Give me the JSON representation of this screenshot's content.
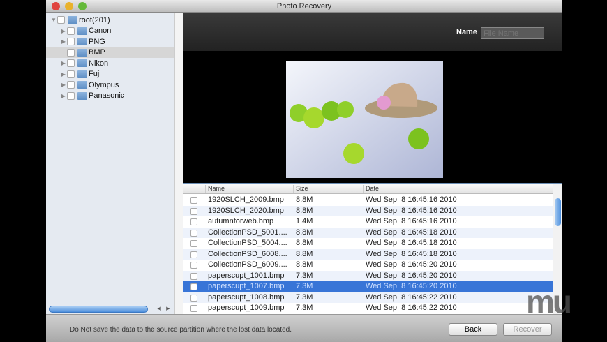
{
  "window": {
    "title": "Photo Recovery"
  },
  "tree": [
    {
      "label": "root(201)",
      "level": 0,
      "expanded": true
    },
    {
      "label": "Canon",
      "level": 1,
      "expandable": true
    },
    {
      "label": "PNG",
      "level": 1,
      "expandable": true
    },
    {
      "label": "BMP",
      "level": 1,
      "expandable": false,
      "selected": true
    },
    {
      "label": "Nikon",
      "level": 1,
      "expandable": true
    },
    {
      "label": "Fuji",
      "level": 1,
      "expandable": true
    },
    {
      "label": "Olympus",
      "level": 1,
      "expandable": true
    },
    {
      "label": "Panasonic",
      "level": 1,
      "expandable": true
    }
  ],
  "search": {
    "label": "Name",
    "placeholder": "File Name"
  },
  "table": {
    "columns": [
      "Name",
      "Size",
      "Date"
    ],
    "rows": [
      {
        "name": "1920SLCH_2009.bmp",
        "size": "8.8M",
        "date": "Wed Sep  8 16:45:16 2010"
      },
      {
        "name": "1920SLCH_2020.bmp",
        "size": "8.8M",
        "date": "Wed Sep  8 16:45:16 2010"
      },
      {
        "name": "autumnforweb.bmp",
        "size": "1.4M",
        "date": "Wed Sep  8 16:45:16 2010"
      },
      {
        "name": "CollectionPSD_5001....",
        "size": "8.8M",
        "date": "Wed Sep  8 16:45:18 2010"
      },
      {
        "name": "CollectionPSD_5004....",
        "size": "8.8M",
        "date": "Wed Sep  8 16:45:18 2010"
      },
      {
        "name": "CollectionPSD_6008....",
        "size": "8.8M",
        "date": "Wed Sep  8 16:45:18 2010"
      },
      {
        "name": "CollectionPSD_6009....",
        "size": "8.8M",
        "date": "Wed Sep  8 16:45:20 2010"
      },
      {
        "name": "paperscupt_1001.bmp",
        "size": "7.3M",
        "date": "Wed Sep  8 16:45:20 2010"
      },
      {
        "name": "paperscupt_1007.bmp",
        "size": "7.3M",
        "date": "Wed Sep  8 16:45:20 2010",
        "selected": true
      },
      {
        "name": "paperscupt_1008.bmp",
        "size": "7.3M",
        "date": "Wed Sep  8 16:45:22 2010"
      },
      {
        "name": "paperscupt_1009.bmp",
        "size": "7.3M",
        "date": "Wed Sep  8 16:45:22 2010"
      }
    ]
  },
  "footer": {
    "warning": "Do Not save the data to the source partition where the lost data located.",
    "back": "Back",
    "recover": "Recover"
  },
  "watermark": "mu"
}
